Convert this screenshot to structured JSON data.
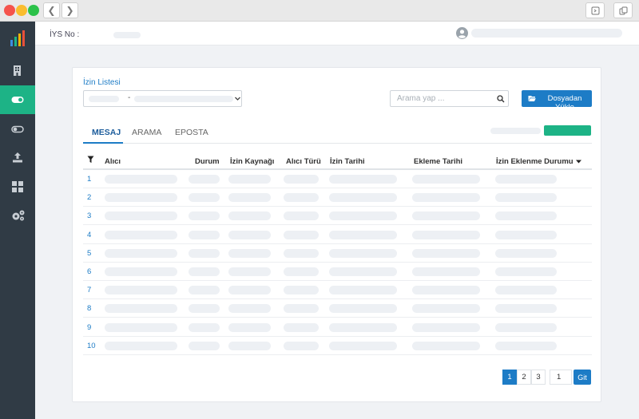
{
  "header": {
    "iys_label": "İYS No :"
  },
  "card": {
    "title": "İzin Listesi",
    "select_separator": "-",
    "search_placeholder": "Arama yap ...",
    "upload_label": "Dosyadan Yükle"
  },
  "tabs": [
    {
      "label": "MESAJ",
      "active": true
    },
    {
      "label": "ARAMA",
      "active": false
    },
    {
      "label": "EPOSTA",
      "active": false
    }
  ],
  "table": {
    "columns": [
      "Alıcı",
      "Durum",
      "İzin Kaynağı",
      "Alıcı Türü",
      "İzin Tarihi",
      "Ekleme Tarihi",
      "İzin Eklenme Durumu"
    ],
    "rows": [
      "1",
      "2",
      "3",
      "4",
      "5",
      "6",
      "7",
      "8",
      "9",
      "10"
    ]
  },
  "pagination": {
    "pages": [
      "1",
      "2",
      "3"
    ],
    "current": "1",
    "goto_value": "1",
    "goto_button": "Git"
  },
  "colors": {
    "accent": "#1d7cc6",
    "success": "#1db386",
    "sidebar": "#303b45"
  }
}
